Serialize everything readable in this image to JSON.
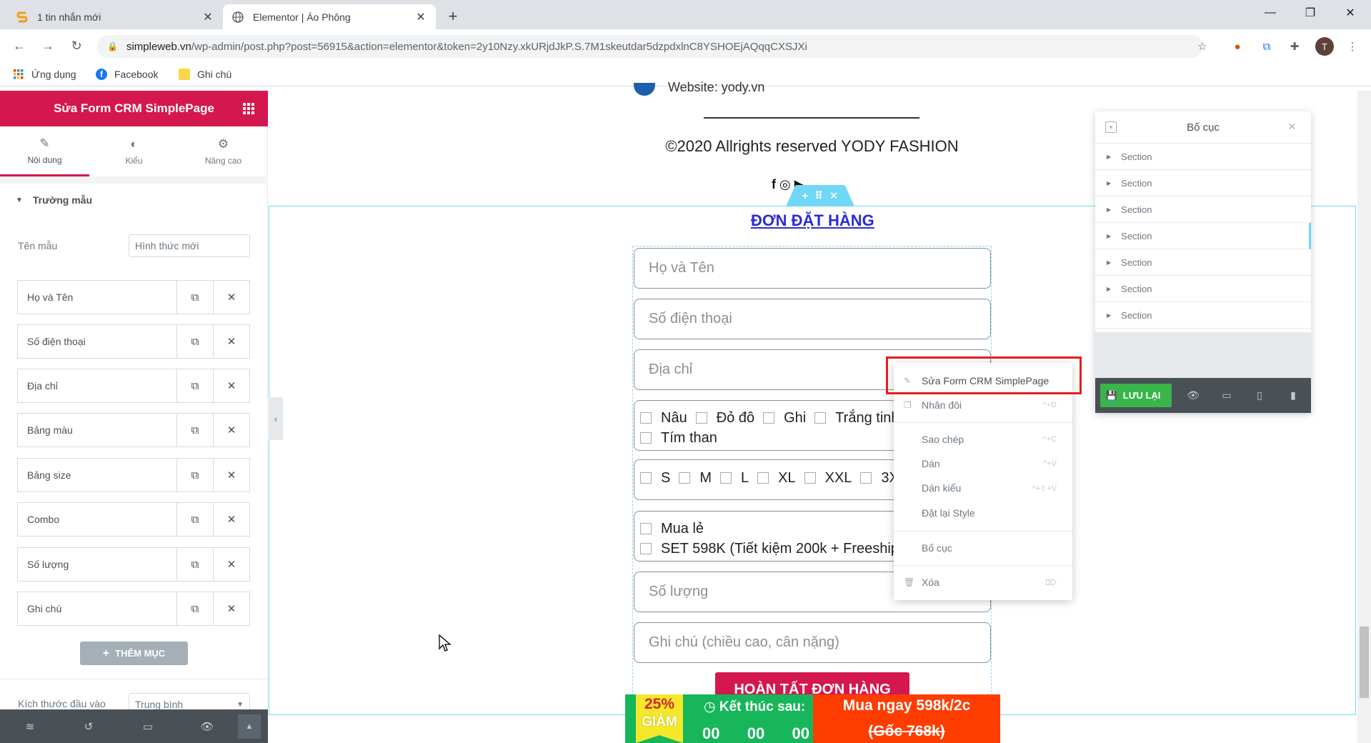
{
  "browser": {
    "tabs": [
      {
        "title": "1 tin nhắn mới",
        "favicon": "s-logo-icon"
      },
      {
        "title": "Elementor | Áo Phông",
        "favicon": "globe-icon"
      }
    ],
    "url_domain": "simpleweb.vn",
    "url_rest": "/wp-admin/post.php?post=56915&action=elementor&token=2y10Nzy.xkURjdJkP.S.7M1skeutdar5dzpdxlnC8YSHOEjAQqqCXSJXi",
    "profile_initial": "T",
    "bookmarks": [
      "Ứng dụng",
      "Facebook",
      "Ghi chú"
    ]
  },
  "panel": {
    "title": "Sửa Form CRM SimplePage",
    "tabs": [
      "Nội dung",
      "Kiểu",
      "Nâng cao"
    ],
    "section_title": "Trường mẫu",
    "form_name_label": "Tên mẫu",
    "form_name_placeholder": "Hình thức mới",
    "fields": [
      "Họ và Tên",
      "Số điện thoại",
      "Địa chỉ",
      "Bảng màu",
      "Bảng size",
      "Combo",
      "Số lượng",
      "Ghi chú"
    ],
    "add_item_label": "THÊM MỤC",
    "input_size_label": "Kích thước đầu vào",
    "input_size_value": "Trung bình"
  },
  "page": {
    "website_text": "Website: yody.vn",
    "copyright": "©2020 Allrights reserved YODY FASHION",
    "social": "f  ◎  ▶",
    "form_title": "ĐƠN ĐẶT HÀNG",
    "ph_name": "Họ và Tên",
    "ph_phone": "Số điện thoại",
    "ph_address": "Địa chỉ",
    "colors": [
      "Nâu",
      "Đỏ đô",
      "Ghi",
      "Trắng tinh",
      "Tím than"
    ],
    "sizes": [
      "S",
      "M",
      "L",
      "XL",
      "XXL",
      "3XL"
    ],
    "combos": [
      "Mua lẻ",
      "SET 598K (Tiết kiệm 200k + Freeship)"
    ],
    "ph_qty": "Số lượng",
    "ph_note": "Ghi chú (chiều cao, cân nặng)",
    "submit": "HOÀN TẤT ĐƠN HÀNG"
  },
  "promo": {
    "percent": "25%",
    "discount": "GIẢM",
    "ends_label": "Kết thúc sau:",
    "timer": [
      "00",
      "00",
      "00"
    ],
    "buy": "Mua ngay 598k/2c",
    "original": "(Gốc 768k)"
  },
  "context_menu": {
    "items": [
      {
        "label": "Sửa Form CRM SimplePage",
        "shortcut": ""
      },
      {
        "label": "Nhân đôi",
        "shortcut": "^+D"
      },
      {
        "label": "Sao chép",
        "shortcut": "^+C"
      },
      {
        "label": "Dán",
        "shortcut": "^+V"
      },
      {
        "label": "Dán kiểu",
        "shortcut": "^+⇧+V"
      },
      {
        "label": "Đặt lại Style",
        "shortcut": ""
      },
      {
        "label": "Bố cục",
        "shortcut": ""
      },
      {
        "label": "Xóa",
        "shortcut": "⌦"
      }
    ]
  },
  "navigator": {
    "title": "Bố cục",
    "sections": [
      "Section",
      "Section",
      "Section",
      "Section",
      "Section",
      "Section",
      "Section"
    ],
    "save_label": "LƯU LẠI"
  }
}
